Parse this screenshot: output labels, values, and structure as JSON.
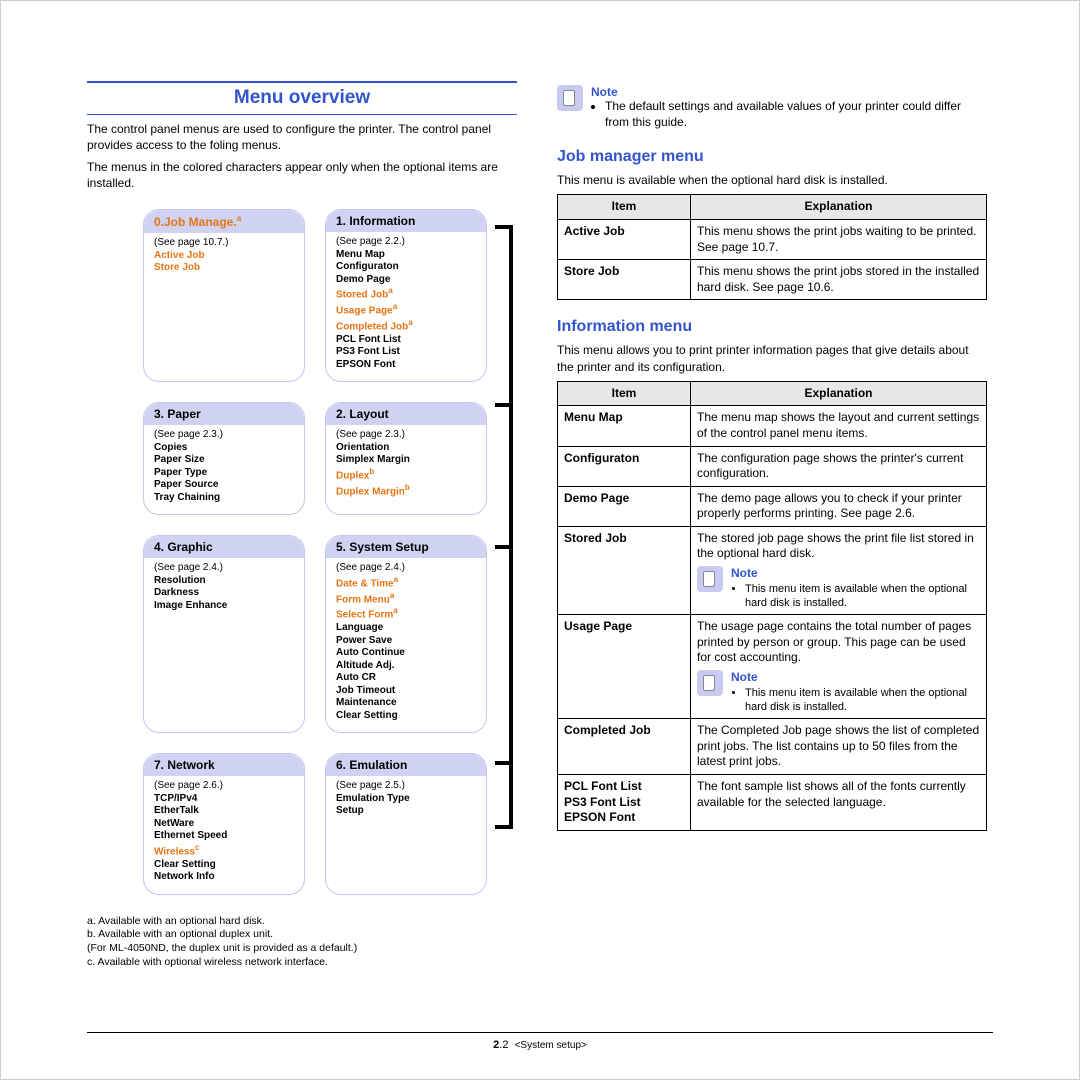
{
  "headings": {
    "overview": "Menu overview",
    "jobManager": "Job manager menu",
    "infoMenu": "Information menu"
  },
  "intro": {
    "p1": "The control panel menus are used to configure the printer. The control panel provides access to the foling menus.",
    "p2": "The menus in the colored characters appear only when the optional items are installed."
  },
  "menus": {
    "m0": {
      "title": "0.Job Manage.",
      "sup": "a",
      "ref": "(See page 10.7.)",
      "items": [
        {
          "t": "Active Job",
          "opt": true
        },
        {
          "t": "Store Job",
          "opt": true
        }
      ]
    },
    "m1": {
      "title": "1. Information",
      "ref": "(See page 2.2.)",
      "items": [
        {
          "t": "Menu Map"
        },
        {
          "t": "Configuraton"
        },
        {
          "t": "Demo Page"
        },
        {
          "t": "Stored Job",
          "opt": true,
          "sup": "a"
        },
        {
          "t": "Usage Page",
          "opt": true,
          "sup": "a"
        },
        {
          "t": "Completed Job",
          "opt": true,
          "sup": "a"
        },
        {
          "t": "PCL Font List"
        },
        {
          "t": "PS3 Font List"
        },
        {
          "t": "EPSON Font"
        }
      ]
    },
    "m3": {
      "title": "3. Paper",
      "ref": "(See page 2.3.)",
      "items": [
        {
          "t": "Copies"
        },
        {
          "t": "Paper Size"
        },
        {
          "t": "Paper Type"
        },
        {
          "t": "Paper Source"
        },
        {
          "t": "Tray Chaining"
        }
      ]
    },
    "m2": {
      "title": "2. Layout",
      "ref": "(See page 2.3.)",
      "items": [
        {
          "t": "Orientation"
        },
        {
          "t": "Simplex Margin"
        },
        {
          "t": "Duplex",
          "opt": true,
          "sup": "b"
        },
        {
          "t": "Duplex Margin",
          "opt": true,
          "sup": "b"
        }
      ]
    },
    "m4": {
      "title": "4. Graphic",
      "ref": "(See page 2.4.)",
      "items": [
        {
          "t": "Resolution"
        },
        {
          "t": "Darkness"
        },
        {
          "t": "Image Enhance"
        }
      ]
    },
    "m5": {
      "title": "5. System Setup",
      "ref": "(See page 2.4.)",
      "items": [
        {
          "t": "Date & Time",
          "opt": true,
          "sup": "a"
        },
        {
          "t": "Form Menu",
          "opt": true,
          "sup": "a"
        },
        {
          "t": "Select Form",
          "opt": true,
          "sup": "a"
        },
        {
          "t": "Language"
        },
        {
          "t": "Power Save"
        },
        {
          "t": "Auto Continue"
        },
        {
          "t": "Altitude Adj."
        },
        {
          "t": "Auto CR"
        },
        {
          "t": "Job Timeout"
        },
        {
          "t": "Maintenance"
        },
        {
          "t": "Clear Setting"
        }
      ]
    },
    "m7": {
      "title": "7. Network",
      "ref": "(See page 2.6.)",
      "items": [
        {
          "t": "TCP/IPv4"
        },
        {
          "t": "EtherTalk"
        },
        {
          "t": "NetWare"
        },
        {
          "t": "Ethernet Speed"
        },
        {
          "t": "Wireless",
          "opt": true,
          "sup": "c"
        },
        {
          "t": "Clear Setting"
        },
        {
          "t": "Network Info"
        }
      ]
    },
    "m6": {
      "title": "6. Emulation",
      "ref": "(See page 2.5.)",
      "items": [
        {
          "t": "Emulation Type"
        },
        {
          "t": "Setup"
        }
      ]
    }
  },
  "footnotes": {
    "a": "a. Available with an optional hard disk.",
    "b": "b. Available with an optional duplex unit.",
    "bx": "(For ML-4050ND, the duplex unit is provided as a default.)",
    "c": "c. Available with optional wireless network interface."
  },
  "rightNote": {
    "title": "Note",
    "bullet": "The default settings and available values of your printer could differ from this guide."
  },
  "jobManagerIntro": "This menu is available when the optional hard disk is installed.",
  "jobTable": {
    "headers": [
      "Item",
      "Explanation"
    ],
    "rows": [
      {
        "item": "Active Job",
        "expl": "This menu shows the print jobs waiting to be printed. See page 10.7."
      },
      {
        "item": "Store Job",
        "expl": "This menu shows the print jobs stored in the installed hard disk. See page 10.6."
      }
    ]
  },
  "infoIntro": "This menu allows you to print printer information pages that give details about the printer and its configuration.",
  "infoTable": {
    "headers": [
      "Item",
      "Explanation"
    ],
    "rows": [
      {
        "item": "Menu Map",
        "expl": "The menu map shows the layout and current settings of the control panel menu items."
      },
      {
        "item": "Configuraton",
        "expl": "The configuration page shows the printer's current configuration."
      },
      {
        "item": "Demo Page",
        "expl": "The demo page allows you to check if your printer properly performs printing. See page 2.6."
      },
      {
        "item": "Stored Job",
        "expl": "The stored job page shows the print file list stored in the optional hard disk.",
        "noteTitle": "Note",
        "noteBullet": "This menu item is available when the optional hard disk is installed."
      },
      {
        "item": "Usage Page",
        "expl": "The usage page contains the total number of pages printed by person or group. This page can be used for cost accounting.",
        "noteTitle": "Note",
        "noteBullet": "This menu item is available when the optional hard disk is installed."
      },
      {
        "item": "Completed Job",
        "expl": "The Completed Job page shows the list of completed print jobs. The list contains up to 50 files from the latest print jobs."
      },
      {
        "item": "PCL Font List\nPS3 Font List\nEPSON Font",
        "expl": "The font sample list shows all of the fonts currently available for the selected language."
      }
    ]
  },
  "footer": {
    "num": "2",
    "sub": ".2",
    "label": "<System setup>"
  }
}
